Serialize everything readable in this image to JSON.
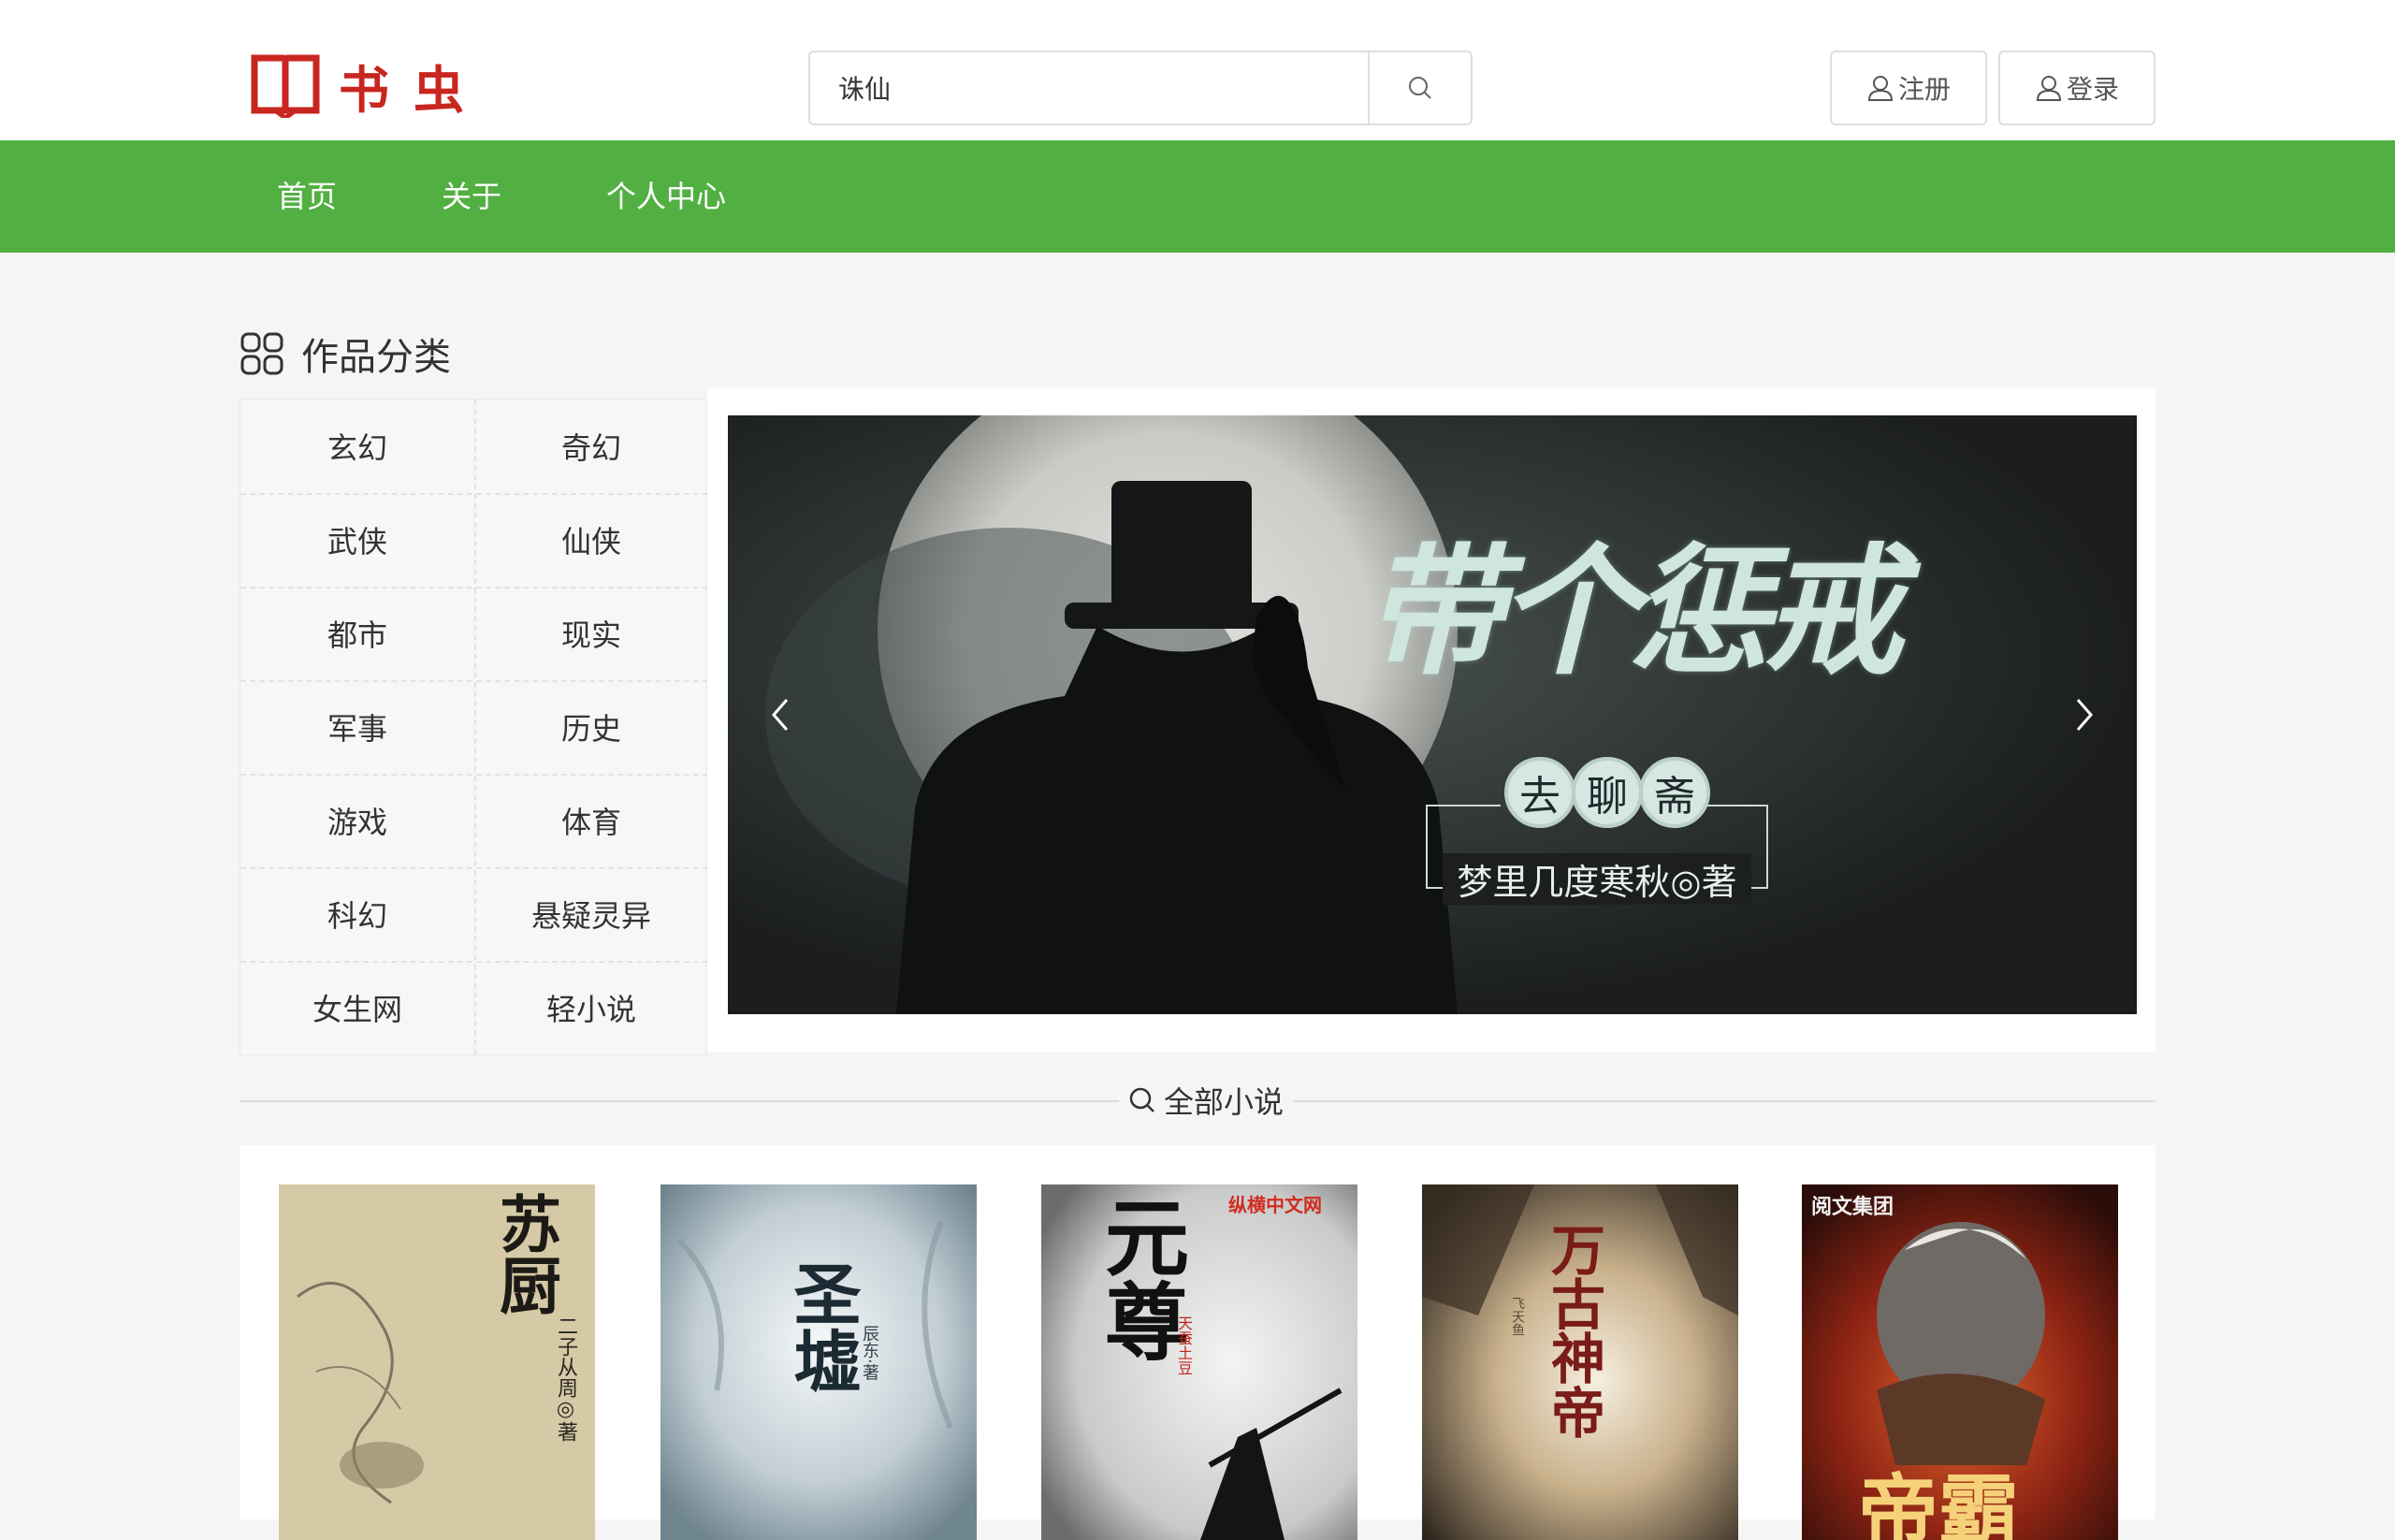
{
  "header": {
    "logo_text": "书虫",
    "search_value": "诛仙",
    "register_label": "注册",
    "login_label": "登录"
  },
  "nav": {
    "items": [
      "首页",
      "关于",
      "个人中心"
    ]
  },
  "categories": {
    "title": "作品分类",
    "items": [
      "玄幻",
      "奇幻",
      "武侠",
      "仙侠",
      "都市",
      "现实",
      "军事",
      "历史",
      "游戏",
      "体育",
      "科幻",
      "悬疑灵异",
      "女生网",
      "轻小说"
    ]
  },
  "banner": {
    "title": "带个惩戒",
    "seal_chars": [
      "去",
      "聊",
      "斋"
    ],
    "author_line": "梦里几度寒秋◎著"
  },
  "novels": {
    "title": "全部小说",
    "books": [
      {
        "cover_title": "苏厨",
        "cover_author": "二子从周◎著",
        "publisher": ""
      },
      {
        "cover_title": "圣墟",
        "cover_author": "辰东·著",
        "publisher": ""
      },
      {
        "cover_title": "元尊",
        "cover_author": "天蚕土豆",
        "publisher": "纵横中文网"
      },
      {
        "cover_title": "万古神帝",
        "cover_author": "飞天鱼",
        "publisher": ""
      },
      {
        "cover_title": "帝霸",
        "cover_author": "",
        "publisher": "阅文集团"
      }
    ]
  },
  "colors": {
    "nav_green": "#52b043",
    "logo_red": "#c8261e",
    "page_bg": "#f5f5f5"
  }
}
